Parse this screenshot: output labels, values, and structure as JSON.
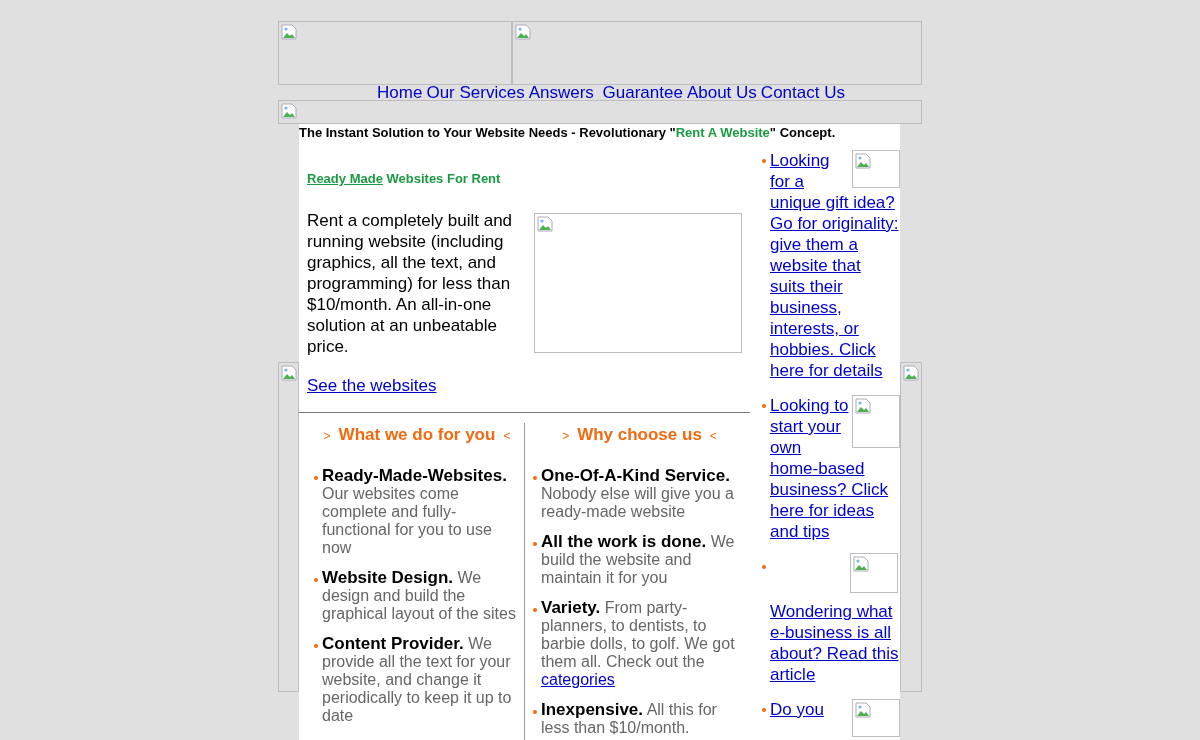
{
  "nav": [
    {
      "label": "Home"
    },
    {
      "label": "Our Services"
    },
    {
      "label": "Answers "
    },
    {
      "label": "Guarantee"
    },
    {
      "label": "About Us"
    },
    {
      "label": "Contact Us"
    }
  ],
  "tagline": {
    "before": "The Instant Solution to Your Website Needs - Revolutionary \"",
    "highlight": "Rent A Website",
    "after": "\" Concept."
  },
  "intro": {
    "heading_link": "Ready Made",
    "heading_rest": "Websites For Rent",
    "text": "Rent a completely built and running website (including graphics, all the text, and programming) for less than $10/month. An all-in-one solution at an unbeatable price.",
    "link": "See the websites"
  },
  "columns": [
    {
      "open_marker": ">",
      "title": "What we do for you",
      "close_marker": "<",
      "items": [
        {
          "title": "Ready-Made-Websites.",
          "text": "Our websites come complete and fully-functional for you to use now"
        },
        {
          "title": "Website Design.",
          "text": "We design and build the graphical layout of the sites"
        },
        {
          "title": "Content Provider.",
          "text": "We provide all the text for your website, and change it periodically to keep it up to date"
        }
      ]
    },
    {
      "open_marker": ">",
      "title": "Why choose us",
      "close_marker": "<",
      "items": [
        {
          "title": "One-Of-A-Kind Service.",
          "text": "Nobody else will give you a ready-made website"
        },
        {
          "title": "All the work is done.",
          "text": "We build the website and maintain it for you"
        },
        {
          "title": "Variety.",
          "text": "From party-planners, to dentists, to barbie dolls, to golf. We got them all. Check out the",
          "link": "categories"
        },
        {
          "title": "Inexpensive.",
          "text": "All this for less than $10/month."
        }
      ]
    }
  ],
  "sidebar": [
    {
      "kind": "wrap",
      "link": "Looking for a unique gift idea? Go for originality: give them a website that suits their business, interests, or hobbies. Click here for details"
    },
    {
      "kind": "wrap",
      "link": "Looking to start your own home-based business? Click here for ideas and tips"
    },
    {
      "kind": "below",
      "link": "Wondering what e-business is all about? Read this article"
    },
    {
      "kind": "wrap",
      "link": "Do you"
    }
  ]
}
